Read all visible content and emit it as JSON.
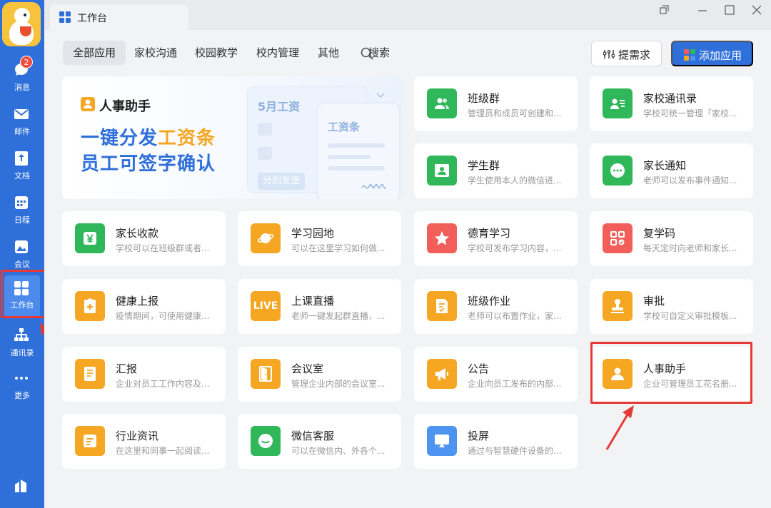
{
  "sidebar": {
    "items": [
      {
        "label": "消息",
        "badge": "2"
      },
      {
        "label": "邮件"
      },
      {
        "label": "文档"
      },
      {
        "label": "日程"
      },
      {
        "label": "会议"
      },
      {
        "label": "工作台"
      },
      {
        "label": "通讯录"
      },
      {
        "label": "更多"
      }
    ]
  },
  "titlebar": {
    "tab_label": "工作台"
  },
  "toolbar": {
    "filters": [
      "全部应用",
      "家校沟通",
      "校园教学",
      "校内管理",
      "其他"
    ],
    "search_label": "搜索",
    "request_label": "提需求",
    "add_app_label": "添加应用"
  },
  "banner": {
    "title": "人事助手",
    "line1_a": "一键分发",
    "line1_b": "工资条",
    "line2": "员工可签字确认",
    "card_back_title": "5月工资",
    "card_back_button": "分别发送",
    "card_front_title": "工资条"
  },
  "apps": [
    {
      "name": "班级群",
      "desc": "管理员和成员可创建和...",
      "color": "#2FB75A"
    },
    {
      "name": "家校通讯录",
      "desc": "学校可统一管理「家校...",
      "color": "#2FB75A"
    },
    {
      "name": "学生群",
      "desc": "学生使用本人的微信进...",
      "color": "#2FB75A"
    },
    {
      "name": "家长通知",
      "desc": "老师可以发布事件通知...",
      "color": "#2FB75A"
    },
    {
      "name": "家长收款",
      "desc": "学校可以在班级群或者...",
      "color": "#2FB75A"
    },
    {
      "name": "学习园地",
      "desc": "可以在这里学习如何做...",
      "color": "#F5A623"
    },
    {
      "name": "德育学习",
      "desc": "学校可发布学习内容，...",
      "color": "#F25E59"
    },
    {
      "name": "复学码",
      "desc": "每天定时向老师和家长...",
      "color": "#F25E59"
    },
    {
      "name": "健康上报",
      "desc": "疫情期间，可使用健康...",
      "color": "#F5A623"
    },
    {
      "name": "上课直播",
      "desc": "老师一键发起群直播，...",
      "color": "#F5A623",
      "icon_text": "LIVE"
    },
    {
      "name": "班级作业",
      "desc": "老师可以布置作业，家...",
      "color": "#F5A623"
    },
    {
      "name": "审批",
      "desc": "学校可自定义审批模板...",
      "color": "#F5A623"
    },
    {
      "name": "汇报",
      "desc": "企业对员工工作内容及...",
      "color": "#F5A623"
    },
    {
      "name": "会议室",
      "desc": "管理企业内部的会议室...",
      "color": "#F5A623"
    },
    {
      "name": "公告",
      "desc": "企业向员工发布的内部...",
      "color": "#F5A623"
    },
    {
      "name": "人事助手",
      "desc": "企业可管理员工花名册...",
      "color": "#F5A623"
    },
    {
      "name": "行业资讯",
      "desc": "在这里和同事一起阅读...",
      "color": "#F5A623"
    },
    {
      "name": "微信客服",
      "desc": "可以在微信内、外各个...",
      "color": "#2FB75A"
    },
    {
      "name": "投屏",
      "desc": "通过与智慧硬件设备的...",
      "color": "#4C94F0"
    }
  ],
  "annotation_color": "#E53935"
}
